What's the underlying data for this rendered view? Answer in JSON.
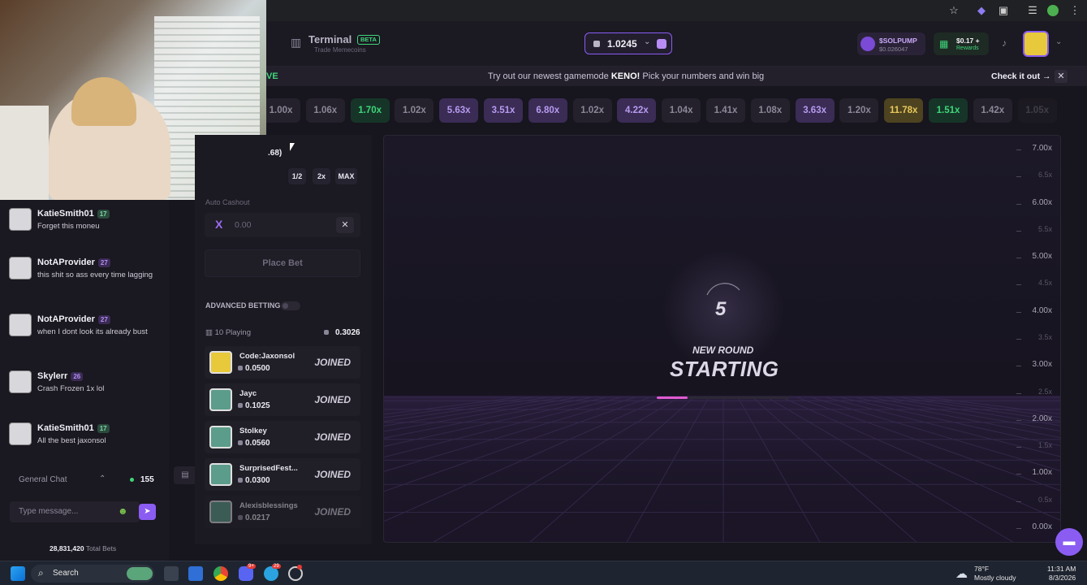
{
  "header": {
    "terminal_title": "Terminal",
    "terminal_badge": "BETA",
    "terminal_sub": "Trade Memecoins",
    "balance": "1.0245",
    "token_name": "$SOLPUMP",
    "token_price": "$0.026047",
    "rewards_value": "$0.17 +",
    "rewards_label": "Rewards"
  },
  "promo": {
    "live_fragment": "VE",
    "text_before": "Try out our newest gamemode ",
    "highlight": "KENO!",
    "text_after": " Pick your numbers and win big",
    "link": "Check it out →"
  },
  "history": [
    "1.00x",
    "1.06x",
    "1.70x",
    "1.02x",
    "5.63x",
    "3.51x",
    "6.80x",
    "1.02x",
    "4.22x",
    "1.04x",
    "1.41x",
    "1.08x",
    "3.63x",
    "1.20x",
    "11.78x",
    "1.51x",
    "1.42x",
    "1.05x"
  ],
  "bet": {
    "amount_fragment": ".68)",
    "half": "1/2",
    "double": "2x",
    "max": "MAX",
    "auto_label": "Auto Cashout",
    "auto_value": "0.00",
    "place_bet": "Place Bet",
    "advanced": "ADVANCED BETTING",
    "playing": "10 Playing",
    "total": "0.3026"
  },
  "players": [
    {
      "name": "Code:Jaxonsol",
      "amount": "0.0500",
      "status": "JOINED"
    },
    {
      "name": "Jayc",
      "amount": "0.1025",
      "status": "JOINED"
    },
    {
      "name": "Stolkey",
      "amount": "0.0560",
      "status": "JOINED"
    },
    {
      "name": "SurprisedFest...",
      "amount": "0.0300",
      "status": "JOINED"
    },
    {
      "name": "Alexisblessings",
      "amount": "0.0217",
      "status": "JOINED"
    }
  ],
  "chat": {
    "messages": [
      {
        "user": "KatieSmith01",
        "level": "17",
        "text": "Forget this moneu"
      },
      {
        "user": "NotAProvider",
        "level": "27",
        "text": "this shit so ass every time lagging"
      },
      {
        "user": "NotAProvider",
        "level": "27",
        "text": "when I dont look its already bust"
      },
      {
        "user": "Skylerr",
        "level": "26",
        "text": "Crash Frozen 1x lol"
      },
      {
        "user": "KatieSmith01",
        "level": "17",
        "text": "All the best jaxonsol"
      }
    ],
    "channel": "General Chat",
    "online": "155",
    "placeholder": "Type message...",
    "total_bets": "28,831,420",
    "total_bets_label": "Total Bets"
  },
  "game": {
    "countdown": "5",
    "line1": "NEW ROUND",
    "line2": "STARTING",
    "countdown_progress": 0.23,
    "y_labels": [
      {
        "t": "7.00x",
        "major": true
      },
      {
        "t": "6.5x",
        "major": false
      },
      {
        "t": "6.00x",
        "major": true
      },
      {
        "t": "5.5x",
        "major": false
      },
      {
        "t": "5.00x",
        "major": true
      },
      {
        "t": "4.5x",
        "major": false
      },
      {
        "t": "4.00x",
        "major": true
      },
      {
        "t": "3.5x",
        "major": false
      },
      {
        "t": "3.00x",
        "major": true
      },
      {
        "t": "2.5x",
        "major": false
      },
      {
        "t": "2.00x",
        "major": true
      },
      {
        "t": "1.5x",
        "major": false
      },
      {
        "t": "1.00x",
        "major": true
      },
      {
        "t": "0.5x",
        "major": false
      },
      {
        "t": "0.00x",
        "major": true
      }
    ]
  },
  "taskbar": {
    "search": "Search",
    "weather_temp": "78°F",
    "weather_desc": "Mostly cloudy",
    "time": "11:31 AM",
    "date": "8/3/2026",
    "badge_1": "9+",
    "badge_2": "29"
  },
  "colors": {
    "accent": "#9b5cf2",
    "green": "#3fd67a",
    "gold": "#e9c85a",
    "pink": "#e05ad0"
  }
}
